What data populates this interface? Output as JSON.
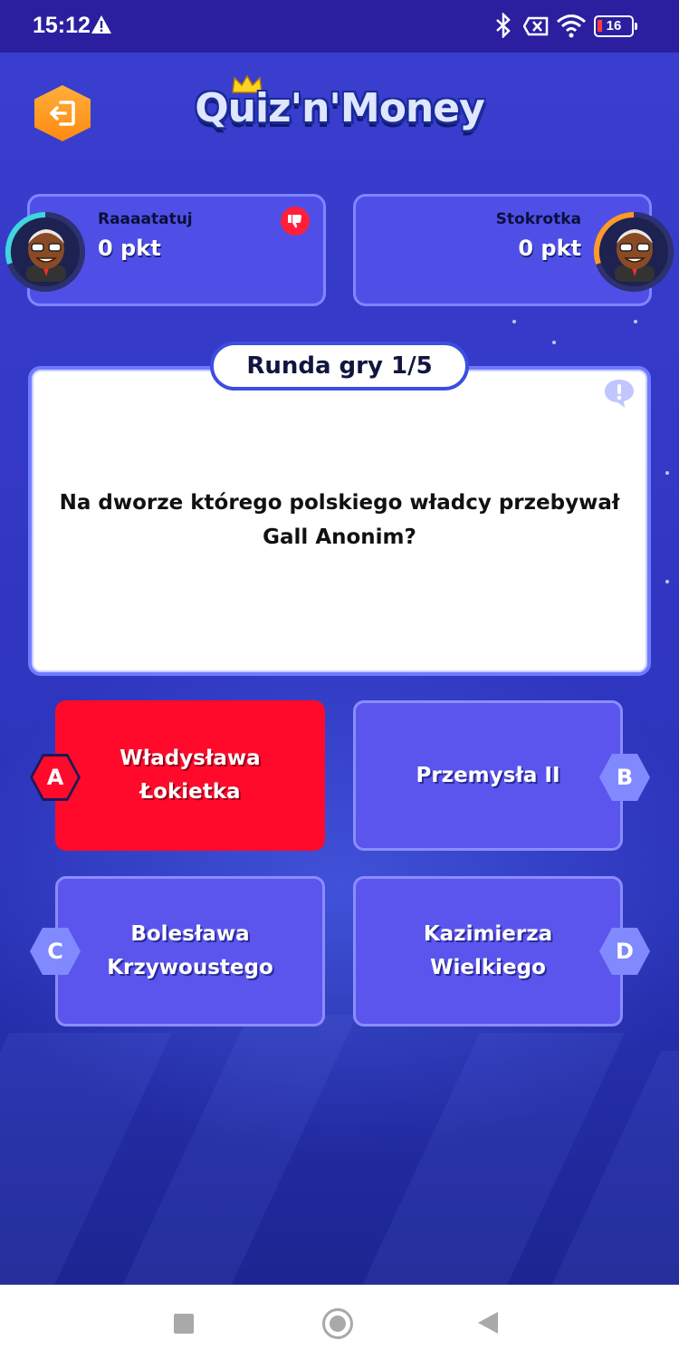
{
  "status_bar": {
    "time": "15:12",
    "battery": "16",
    "icons": [
      "warning-icon",
      "bluetooth-icon",
      "no-sim-icon",
      "wifi-icon",
      "battery-icon"
    ]
  },
  "header": {
    "logo_text": "Quiz'n'Money",
    "exit_icon": "exit-icon"
  },
  "players": [
    {
      "name": "Raaaatatuj",
      "score": "0 pkt",
      "badge": "thumbs-down-icon"
    },
    {
      "name": "Stokrotka",
      "score": "0 pkt"
    }
  ],
  "question": {
    "round": "Runda gry 1/5",
    "text": "Na dworze którego polskiego władcy przebywał Gall Anonim?",
    "report_icon": "report-bubble-icon"
  },
  "answers": [
    {
      "letter": "A",
      "label": "Władysława\nŁokietka",
      "selected": true
    },
    {
      "letter": "B",
      "label": "Przemysła II",
      "selected": false
    },
    {
      "letter": "C",
      "label": "Bolesława\nKrzywoustego",
      "selected": false
    },
    {
      "letter": "D",
      "label": "Kazimierza\nWielkiego",
      "selected": false
    }
  ],
  "colors": {
    "background": "#3438c6",
    "card": "#4f4fe8",
    "answer": "#5b55ee",
    "selected": "#ff0a2a",
    "exit_button": "#ff9a1f"
  },
  "nav_bar": [
    "recents-button",
    "home-button",
    "back-button"
  ]
}
